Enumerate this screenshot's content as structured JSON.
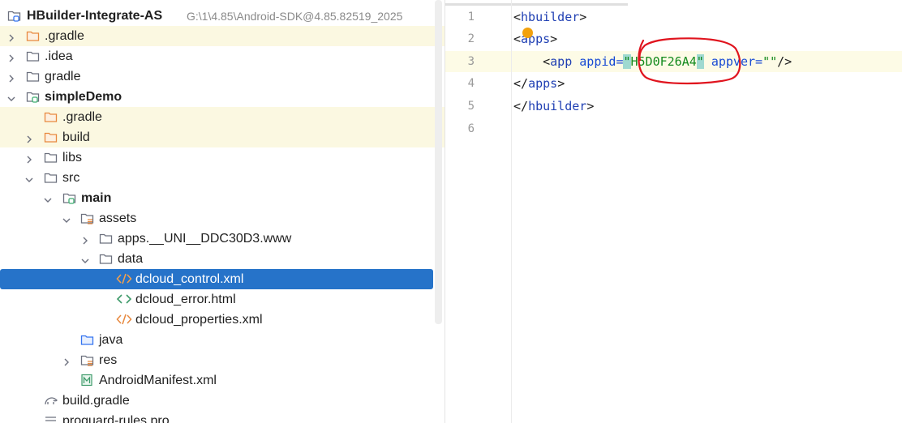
{
  "project_tree": {
    "root": {
      "label": "HBuilder-Integrate-AS",
      "path_hint": "G:\\1\\4.85\\Android-SDK@4.85.82519_2025"
    },
    "items": [
      {
        "label": ".gradle",
        "icon": "folder-orange-icon"
      },
      {
        "label": ".idea",
        "icon": "folder-icon"
      },
      {
        "label": "gradle",
        "icon": "folder-icon"
      },
      {
        "label": "simpleDemo",
        "icon": "module-folder-icon"
      },
      {
        "label": ".gradle",
        "icon": "folder-orange-icon"
      },
      {
        "label": "build",
        "icon": "folder-orange-icon"
      },
      {
        "label": "libs",
        "icon": "folder-icon"
      },
      {
        "label": "src",
        "icon": "folder-icon"
      },
      {
        "label": "main",
        "icon": "source-root-folder-icon"
      },
      {
        "label": "assets",
        "icon": "resources-folder-icon"
      },
      {
        "label": "apps.__UNI__DDC30D3.www",
        "icon": "folder-icon"
      },
      {
        "label": "data",
        "icon": "folder-icon"
      },
      {
        "label": "dcloud_control.xml",
        "icon": "xml-file-icon"
      },
      {
        "label": "dcloud_error.html",
        "icon": "html-file-icon"
      },
      {
        "label": "dcloud_properties.xml",
        "icon": "xml-file-icon"
      },
      {
        "label": "java",
        "icon": "java-source-folder-icon"
      },
      {
        "label": "res",
        "icon": "resources-folder-icon"
      },
      {
        "label": "AndroidManifest.xml",
        "icon": "manifest-file-icon"
      },
      {
        "label": "build.gradle",
        "icon": "gradle-file-icon"
      },
      {
        "label": "proguard-rules.pro",
        "icon": "text-file-icon"
      }
    ]
  },
  "editor": {
    "line_numbers": [
      "1",
      "2",
      "3",
      "4",
      "5",
      "6"
    ],
    "code": {
      "l1": {
        "open": "<",
        "name": "hbuilder",
        "close": ">"
      },
      "l2": {
        "open": "<",
        "name": "apps",
        "close": ">"
      },
      "l3": {
        "indent": "    ",
        "open": "<",
        "name": "app",
        "attr1": "appid",
        "eq1": "=",
        "q": "\"",
        "appid_value": "H5D0F26A4",
        "attr2": "appver",
        "eq2": "=",
        "appver_value": "\"\"",
        "end": "/>"
      },
      "l4": {
        "open": "</",
        "name": "apps",
        "close": ">"
      },
      "l5": {
        "open": "</",
        "name": "hbuilder",
        "close": ">"
      }
    }
  },
  "colors": {
    "selection": "#2673c9",
    "folder_orange": "#f6a14b",
    "folder_gray": "#6c707e",
    "xml_icon": "#e8893f",
    "html_icon": "#3f9b6b",
    "annotation": "#e0141e",
    "tag": "#1f3fb3",
    "string": "#138a1d"
  }
}
